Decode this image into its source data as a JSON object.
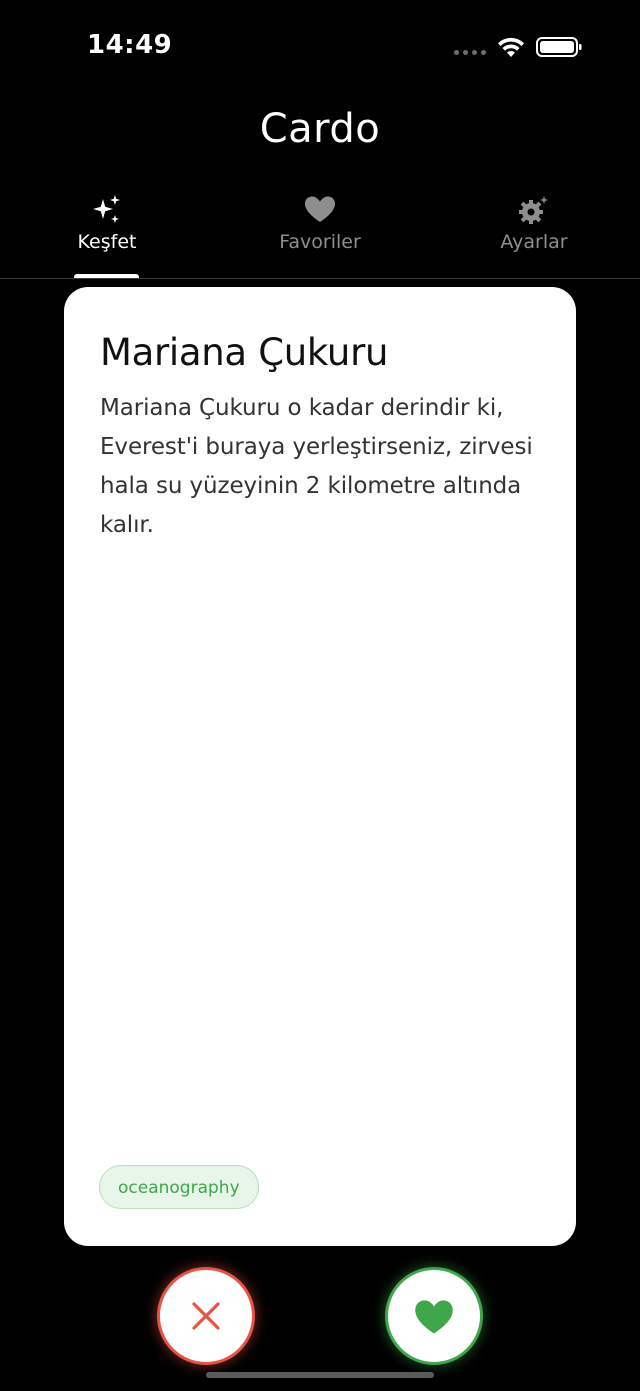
{
  "status_bar": {
    "time": "14:49"
  },
  "app": {
    "title": "Cardo"
  },
  "tabs": [
    {
      "label": "Keşfet",
      "icon": "sparkles-icon",
      "active": true
    },
    {
      "label": "Favoriler",
      "icon": "heart-icon",
      "active": false
    },
    {
      "label": "Ayarlar",
      "icon": "gear-icon",
      "active": false
    }
  ],
  "card": {
    "title": "Mariana Çukuru",
    "body": "Mariana Çukuru o kadar derindir ki, Everest'i buraya yerleştirseniz, zirvesi hala su yüzeyinin 2 kilometre altında kalır.",
    "tag": "oceanography"
  },
  "actions": {
    "dislike_icon": "close-icon",
    "like_icon": "heart-icon"
  },
  "colors": {
    "background": "#000000",
    "card": "#ffffff",
    "dislike": "#e85444",
    "like": "#3fa64a",
    "tag_bg": "#e8f5e9",
    "inactive_tab": "#8e8e8e"
  }
}
